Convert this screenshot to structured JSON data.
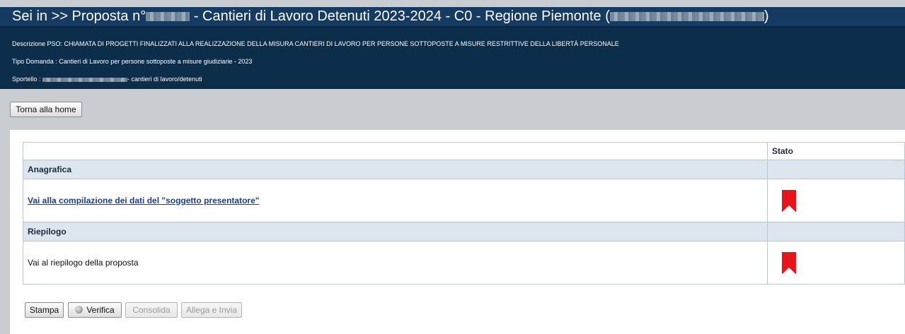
{
  "header": {
    "title_prefix": "Sei in >> Proposta n°",
    "title_middle": " - Cantieri di Lavoro Detenuti 2023-2024 - C0 - Regione Piemonte (",
    "title_suffix": ")",
    "descrizione": "Descrizione PSO: CHIAMATA DI PROGETTI FINALIZZATI ALLA REALIZZAZIONE DELLA MISURA CANTIERI DI LAVORO PER PERSONE SOTTOPOSTE A MISURE RESTRITTIVE DELLA LIBERTÀ PERSONALE",
    "tipo_domanda": "Tipo Domanda : Cantieri di Lavoro per persone sottoposte a misure giudiziarie - 2023",
    "sportello_label": "Sportello :",
    "sportello_suffix": "- cantieri di lavoro/detenuti"
  },
  "nav": {
    "home_label": "Torna alla home"
  },
  "table": {
    "stato_header": "Stato",
    "sections": [
      {
        "label": "Anagrafica",
        "item": "Vai alla compilazione dei dati del \"soggetto presentatore\"",
        "item_is_link": true,
        "status_icon": "bookmark-icon",
        "status_color": "#e8141c"
      },
      {
        "label": "Riepilogo",
        "item": "Vai al riepilogo della proposta",
        "item_is_link": false,
        "status_icon": "bookmark-icon",
        "status_color": "#e8141c"
      }
    ]
  },
  "actions": {
    "stampa": "Stampa",
    "verifica": "Verifica",
    "consolida": "Consolida",
    "allega": "Allega e Invia"
  },
  "colors": {
    "header_bg": "#0d2e4b",
    "title_bar_bg": "#153b62",
    "section_bg": "#dde6ef",
    "link": "#1b3f8f"
  }
}
